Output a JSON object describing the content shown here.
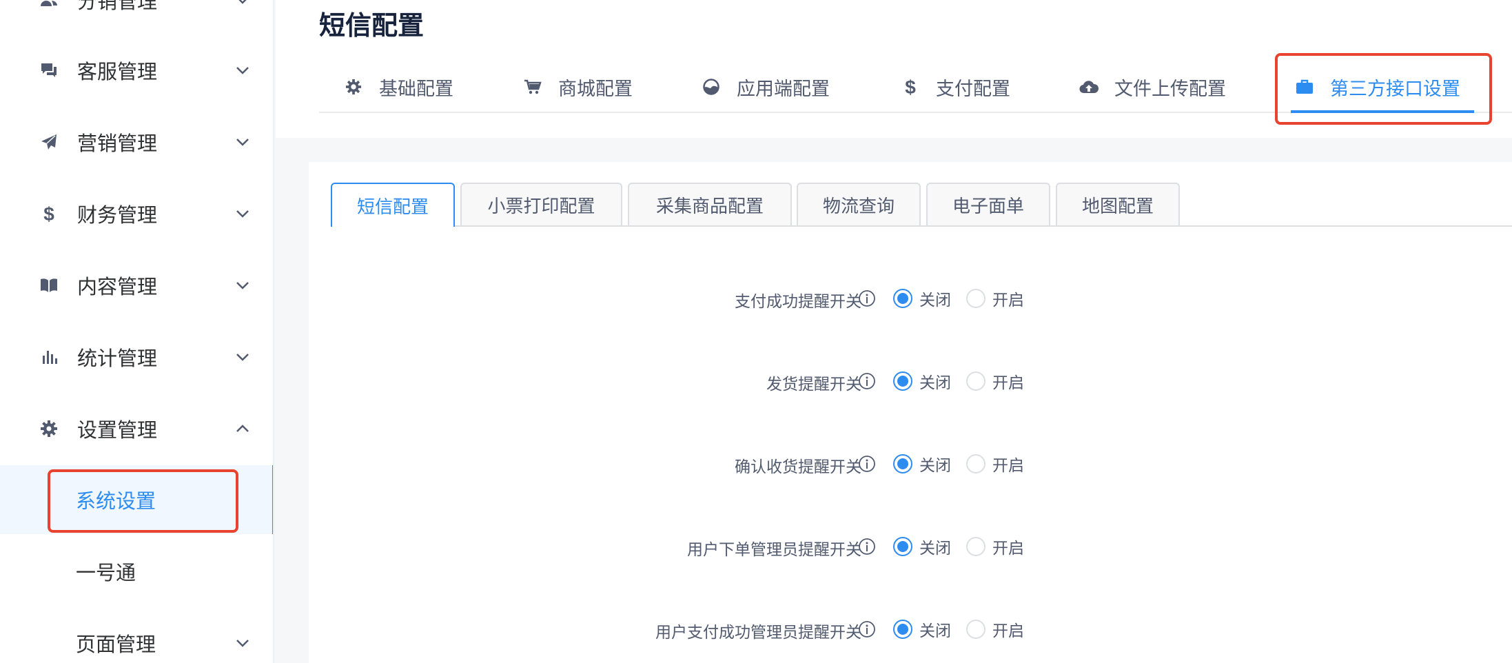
{
  "sidebar": {
    "items": [
      {
        "label": "分销管理",
        "icon": "users-icon",
        "expanded": false
      },
      {
        "label": "客服管理",
        "icon": "chat-icon",
        "expanded": false
      },
      {
        "label": "营销管理",
        "icon": "paper-plane-icon",
        "expanded": false
      },
      {
        "label": "财务管理",
        "icon": "dollar-icon",
        "expanded": false
      },
      {
        "label": "内容管理",
        "icon": "book-icon",
        "expanded": false
      },
      {
        "label": "统计管理",
        "icon": "bar-chart-icon",
        "expanded": false
      },
      {
        "label": "设置管理",
        "icon": "gear-icon",
        "expanded": true
      }
    ],
    "subitems": [
      {
        "label": "系统设置",
        "active": true
      },
      {
        "label": "一号通",
        "active": false
      },
      {
        "label": "页面管理",
        "active": false
      }
    ]
  },
  "header": {
    "title": "短信配置",
    "tabs": [
      {
        "label": "基础配置",
        "icon": "gear-icon",
        "active": false
      },
      {
        "label": "商城配置",
        "icon": "cart-icon",
        "active": false
      },
      {
        "label": "应用端配置",
        "icon": "app-icon",
        "active": false
      },
      {
        "label": "支付配置",
        "icon": "dollar-icon",
        "active": false
      },
      {
        "label": "文件上传配置",
        "icon": "cloud-upload-icon",
        "active": false
      },
      {
        "label": "第三方接口设置",
        "icon": "briefcase-icon",
        "active": true
      }
    ]
  },
  "content": {
    "subtabs": [
      {
        "label": "短信配置",
        "active": true
      },
      {
        "label": "小票打印配置",
        "active": false
      },
      {
        "label": "采集商品配置",
        "active": false
      },
      {
        "label": "物流查询",
        "active": false
      },
      {
        "label": "电子面单",
        "active": false
      },
      {
        "label": "地图配置",
        "active": false
      }
    ],
    "form": [
      {
        "label": "支付成功提醒开关",
        "value": "关闭"
      },
      {
        "label": "发货提醒开关",
        "value": "关闭"
      },
      {
        "label": "确认收货提醒开关",
        "value": "关闭"
      },
      {
        "label": "用户下单管理员提醒开关",
        "value": "关闭"
      },
      {
        "label": "用户支付成功管理员提醒开关",
        "value": "关闭"
      }
    ],
    "radio_options": {
      "off": "关闭",
      "on": "开启"
    }
  },
  "colors": {
    "accent": "#2d8cf0",
    "highlight": "#e8432f",
    "text": "#515a6e",
    "sidebar_text": "#303133"
  }
}
